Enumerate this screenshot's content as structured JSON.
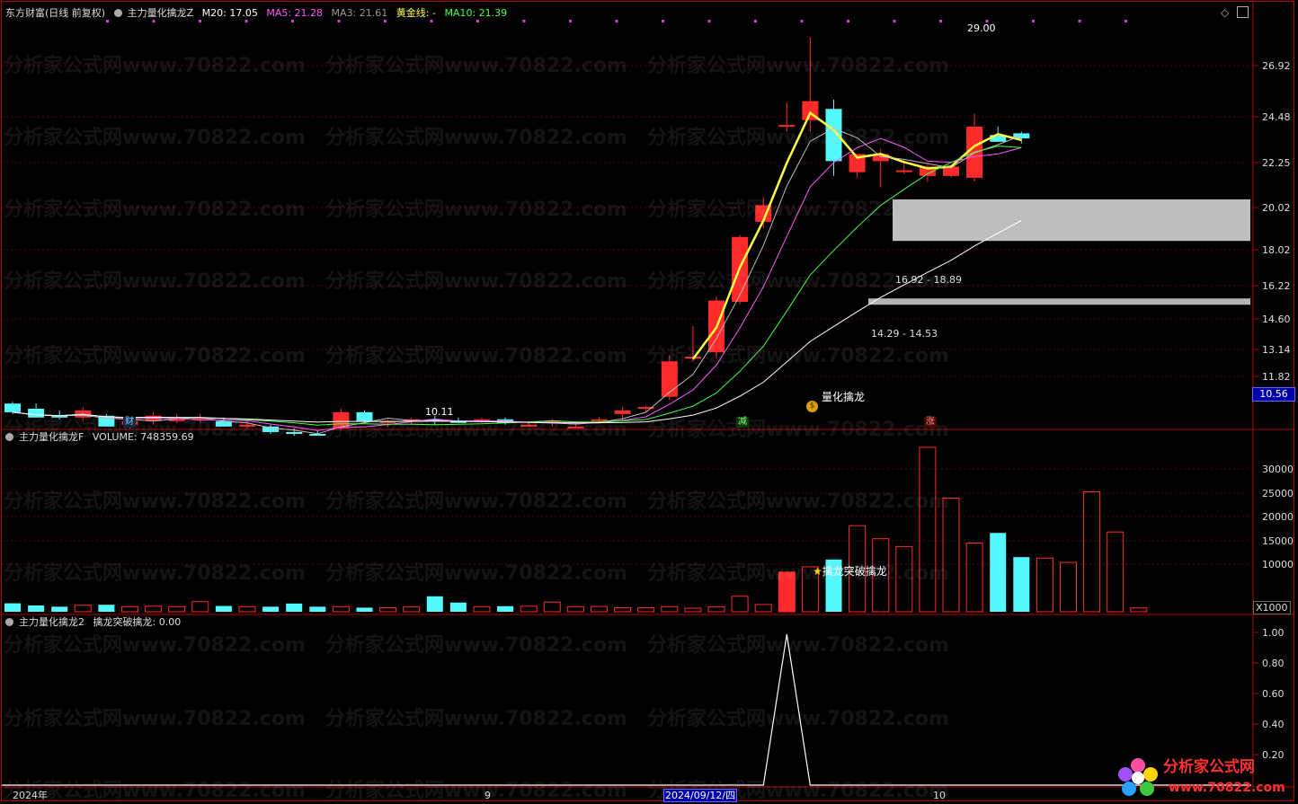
{
  "header": {
    "app_title": "东方财富(日线 前复权)",
    "indicator_name": "主力量化擒龙Z",
    "m20": "M20: 17.05",
    "ma5": "MA5: 21.28",
    "ma3": "MA3: 21.61",
    "gold_line": "黄金线: -",
    "ma10": "MA10: 21.39"
  },
  "price_axis": [
    "26.92",
    "24.48",
    "22.25",
    "20.02",
    "18.02",
    "16.22",
    "14.60",
    "13.14",
    "11.82"
  ],
  "price_current": "10.56",
  "annotations": {
    "high": "29.00",
    "low": "10.11",
    "zone_upper": "16.92 - 18.89",
    "zone_lower": "14.29 - 14.53",
    "signal": "量化擒龙",
    "marker_cai": "财",
    "marker_jian": "减",
    "marker_zhang": "涨"
  },
  "volume_panel": {
    "title": "主力量化擒龙F",
    "volume_label": "VOLUME: 748359.69",
    "axis": [
      "30000",
      "25000",
      "20000",
      "15000",
      "10000"
    ],
    "unit": "X1000",
    "signal": "擒龙突破擒龙"
  },
  "signal_panel": {
    "title": "主力量化擒龙2",
    "label": "擒龙突破擒龙: 0.00",
    "axis": [
      "1.00",
      "0.80",
      "0.60",
      "0.40",
      "0.20"
    ]
  },
  "date_axis": {
    "year": "2024年",
    "m9": "9",
    "cursor": "2024/09/12/四",
    "m10": "10"
  },
  "watermark": "分析家公式网www.70822.com",
  "logo": {
    "name": "分析家公式网",
    "url": "www.70822.com"
  },
  "colors": {
    "up": "#ff2a2a",
    "down": "#54f8ff",
    "ma_yellow": "#ffff44",
    "ma_pink": "#ff55ff",
    "ma_green": "#44ff44",
    "ma_white": "#ffffff",
    "panel_border": "#b00000"
  },
  "chart_data": [
    {
      "type": "candlestick",
      "title": "主力量化擒龙Z",
      "ohlc": [
        [
          11.0,
          11.05,
          10.7,
          10.75
        ],
        [
          10.85,
          11.0,
          10.6,
          10.6
        ],
        [
          10.65,
          10.8,
          10.55,
          10.6
        ],
        [
          10.6,
          10.9,
          10.5,
          10.8
        ],
        [
          10.65,
          10.7,
          10.35,
          10.35
        ],
        [
          10.4,
          10.55,
          10.3,
          10.5
        ],
        [
          10.5,
          10.75,
          10.4,
          10.65
        ],
        [
          10.55,
          10.7,
          10.45,
          10.55
        ],
        [
          10.55,
          10.7,
          10.45,
          10.6
        ],
        [
          10.5,
          10.6,
          10.35,
          10.35
        ],
        [
          10.4,
          10.5,
          10.3,
          10.4
        ],
        [
          10.35,
          10.4,
          10.15,
          10.2
        ],
        [
          10.2,
          10.3,
          10.1,
          10.15
        ],
        [
          10.15,
          10.25,
          10.11,
          10.12
        ],
        [
          10.3,
          10.85,
          10.25,
          10.75
        ],
        [
          10.75,
          10.8,
          10.45,
          10.5
        ],
        [
          10.45,
          10.55,
          10.35,
          10.5
        ],
        [
          10.5,
          10.6,
          10.4,
          10.55
        ],
        [
          10.55,
          10.65,
          10.4,
          10.5
        ],
        [
          10.5,
          10.6,
          10.45,
          10.45
        ],
        [
          10.5,
          10.6,
          10.45,
          10.55
        ],
        [
          10.55,
          10.6,
          10.4,
          10.45
        ],
        [
          10.4,
          10.5,
          10.35,
          10.4
        ],
        [
          10.45,
          10.55,
          10.35,
          10.5
        ],
        [
          10.35,
          10.5,
          10.3,
          10.35
        ],
        [
          10.55,
          10.6,
          10.45,
          10.55
        ],
        [
          10.7,
          10.9,
          10.5,
          10.8
        ],
        [
          10.85,
          10.95,
          10.75,
          10.9
        ],
        [
          11.2,
          12.5,
          11.1,
          12.3
        ],
        [
          12.45,
          13.5,
          12.3,
          12.45
        ],
        [
          12.6,
          14.6,
          12.4,
          14.45
        ],
        [
          14.4,
          17.2,
          14.3,
          17.1
        ],
        [
          17.8,
          19.0,
          17.5,
          18.6
        ],
        [
          23.0,
          24.4,
          22.6,
          23.0
        ],
        [
          23.3,
          29.0,
          22.6,
          24.5
        ],
        [
          24.0,
          24.6,
          20.1,
          20.9
        ],
        [
          20.3,
          21.3,
          20.0,
          21.3
        ],
        [
          20.9,
          21.6,
          19.5,
          21.3
        ],
        [
          20.4,
          21.0,
          20.2,
          20.4
        ],
        [
          20.1,
          20.7,
          19.8,
          20.6
        ],
        [
          20.1,
          20.6,
          20.0,
          20.6
        ],
        [
          20.0,
          23.7,
          19.8,
          22.9
        ],
        [
          22.4,
          22.9,
          22.0,
          22.0
        ],
        [
          22.5,
          22.6,
          21.9,
          22.2
        ]
      ],
      "ma_series": [
        {
          "name": "黄金线",
          "color": "#ffff44"
        },
        {
          "name": "MA3",
          "color": "#cccccc"
        },
        {
          "name": "MA5",
          "color": "#ff55ff"
        },
        {
          "name": "MA10",
          "color": "#44ff44"
        },
        {
          "name": "M20",
          "color": "#ffffff"
        }
      ],
      "zones": [
        [
          16.92,
          18.89
        ],
        [
          14.29,
          14.53
        ]
      ]
    },
    {
      "type": "bar",
      "title": "主力量化擒龙F",
      "values": [
        1750,
        1300,
        1050,
        1350,
        1450,
        1050,
        1150,
        1050,
        2100,
        1200,
        1050,
        1050,
        1700,
        1050,
        1050,
        850,
        850,
        1000,
        3200,
        1900,
        1050,
        1150,
        1150,
        2000,
        1050,
        1100,
        850,
        850,
        1050,
        750,
        1000,
        3200,
        1500,
        8200,
        9300,
        10800,
        17800,
        15100,
        13500,
        34000,
        23500,
        14200,
        16300,
        11300,
        11100,
        10200,
        24800,
        16500,
        800
      ],
      "ylabel": "X1000",
      "ylim": [
        0,
        34000
      ]
    },
    {
      "type": "line",
      "title": "主力量化擒龙2",
      "values": [
        0,
        0,
        0,
        0,
        0,
        0,
        0,
        0,
        0,
        0,
        0,
        0,
        0,
        0,
        0,
        0,
        0,
        0,
        0,
        0,
        0,
        0,
        0,
        0,
        0,
        0,
        0,
        0,
        0,
        0,
        0,
        0,
        0,
        1,
        0,
        0,
        0,
        0,
        0,
        0,
        0,
        0,
        0,
        0,
        0,
        0,
        0,
        0,
        0
      ],
      "ylim": [
        0,
        1.0
      ]
    }
  ]
}
